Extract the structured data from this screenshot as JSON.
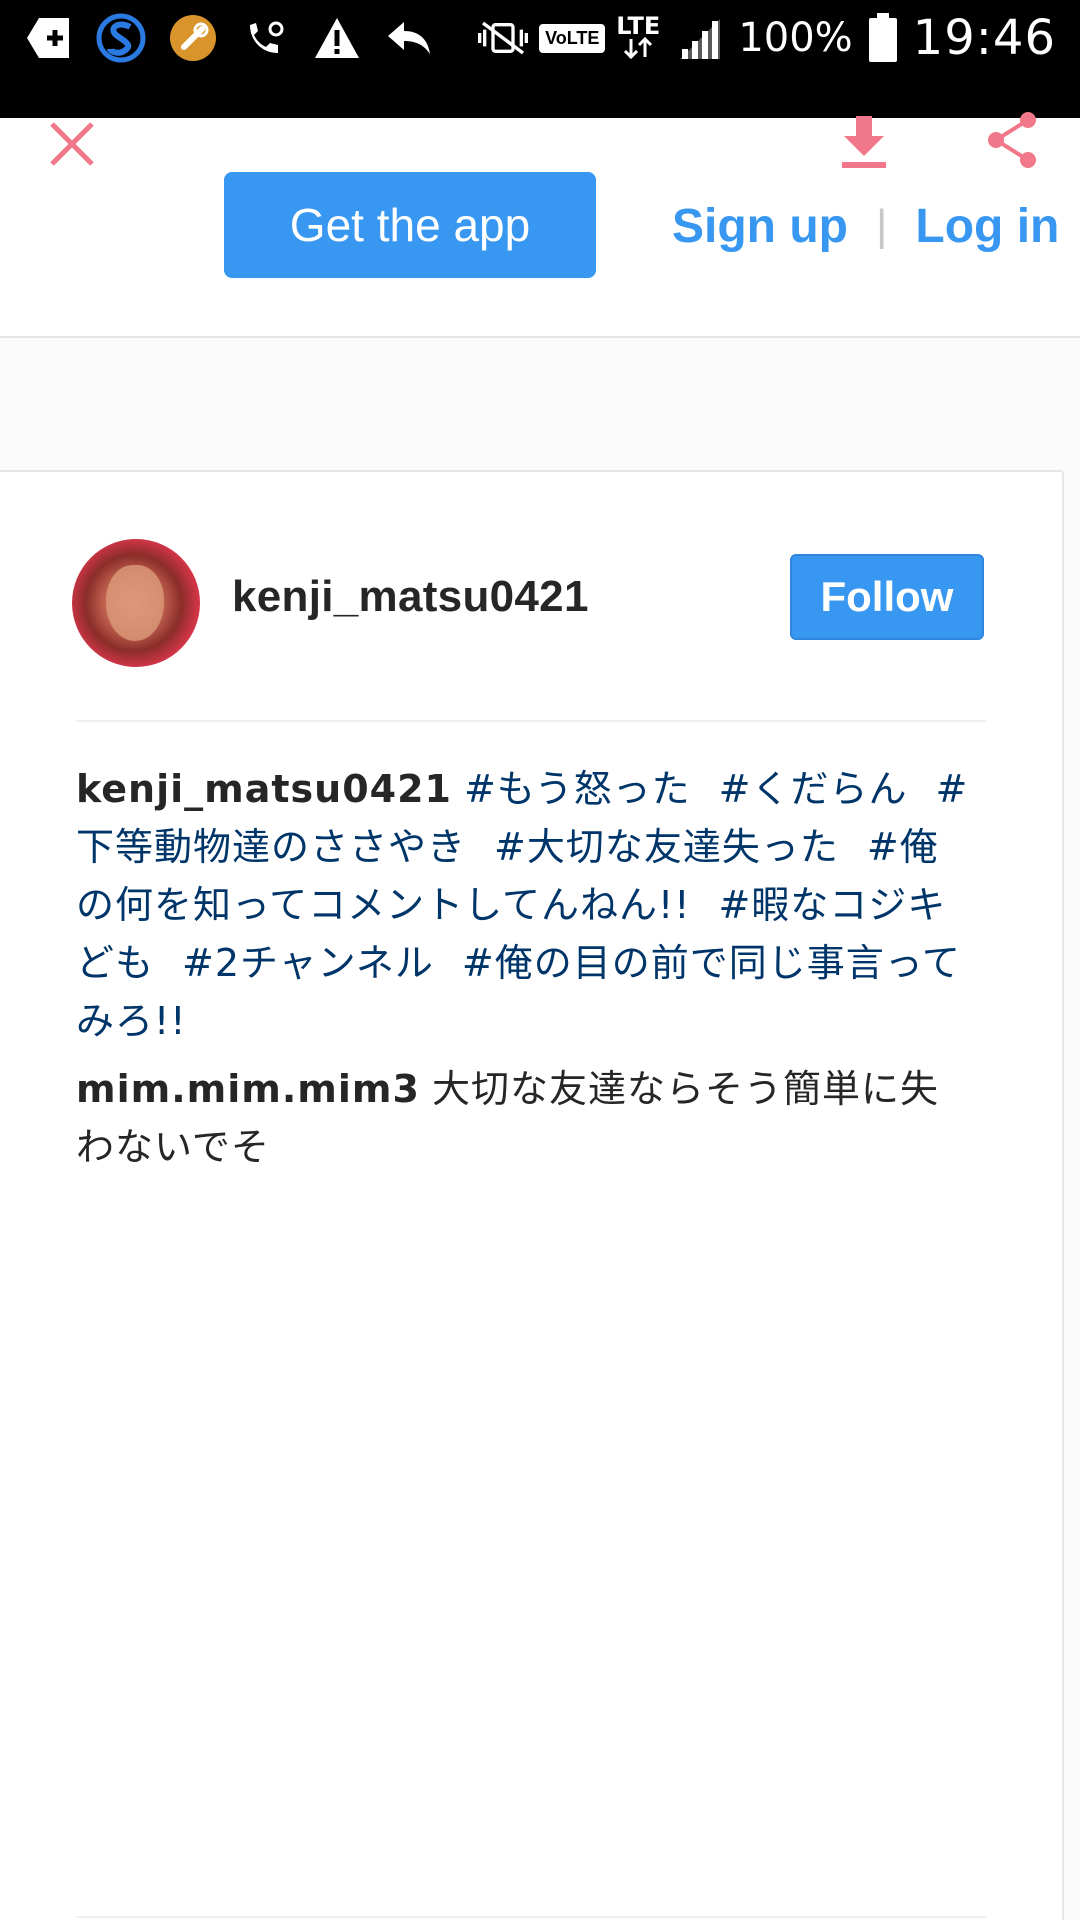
{
  "status_bar": {
    "battery": "100%",
    "time": "19:46",
    "network": "LTE",
    "volte": "VoLTE"
  },
  "toolbar": {
    "get_app_label": "Get the app",
    "sign_up_label": "Sign up",
    "separator": "|",
    "log_in_label": "Log in",
    "accent_color": "#f0788a"
  },
  "post": {
    "username": "kenji_matsu0421",
    "follow_label": "Follow",
    "caption": {
      "user": "kenji_matsu0421",
      "tags": [
        "#もう怒った",
        "#くだらん",
        "#下等動物達のささやき",
        "#大切な友達失った",
        "#俺の何を知ってコメントしてんねん!!",
        "#暇なコジキども",
        "#2チャンネル",
        "#俺の目の前で同じ事言ってみろ!!"
      ]
    },
    "comment": {
      "user": "mim.mim.mim3",
      "text": "大切な友達ならそう簡単に失わないでそ"
    }
  },
  "colors": {
    "brand_blue": "#3897f0",
    "hashtag": "#003569",
    "text": "#262626"
  }
}
